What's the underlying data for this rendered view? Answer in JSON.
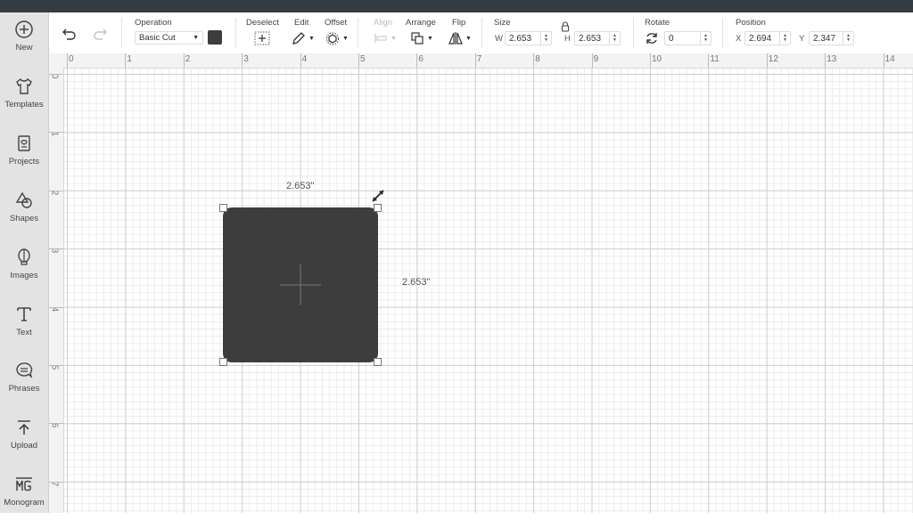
{
  "sidebar": {
    "items": [
      {
        "label": "New",
        "icon": "plus-circle-icon"
      },
      {
        "label": "Templates",
        "icon": "tshirt-icon"
      },
      {
        "label": "Projects",
        "icon": "projects-icon"
      },
      {
        "label": "Shapes",
        "icon": "shapes-icon"
      },
      {
        "label": "Images",
        "icon": "balloon-icon"
      },
      {
        "label": "Text",
        "icon": "text-icon"
      },
      {
        "label": "Phrases",
        "icon": "speech-bubble-icon"
      },
      {
        "label": "Upload",
        "icon": "upload-icon"
      },
      {
        "label": "Monogram",
        "icon": "monogram-icon"
      }
    ]
  },
  "toolbar": {
    "operation_label": "Operation",
    "operation_value": "Basic Cut",
    "operation_color": "#3d3d3d",
    "deselect_label": "Deselect",
    "edit_label": "Edit",
    "offset_label": "Offset",
    "align_label": "Align",
    "arrange_label": "Arrange",
    "flip_label": "Flip",
    "size_label": "Size",
    "w_label": "W",
    "w_value": "2.653",
    "h_label": "H",
    "h_value": "2.653",
    "rotate_label": "Rotate",
    "rotate_value": "0",
    "position_label": "Position",
    "x_label": "X",
    "x_value": "2.694",
    "y_label": "Y",
    "y_value": "2.347"
  },
  "rulers": {
    "horizontal": [
      "0",
      "1",
      "2",
      "3",
      "4",
      "5",
      "6",
      "7",
      "8",
      "9",
      "10",
      "11",
      "12",
      "13",
      "14"
    ],
    "vertical": [
      "0",
      "1",
      "2",
      "3",
      "4",
      "5",
      "6",
      "7"
    ]
  },
  "canvas": {
    "shape_fill": "#3d3d3d",
    "width_dim_label": "2.653\"",
    "height_dim_label": "2.653\""
  }
}
